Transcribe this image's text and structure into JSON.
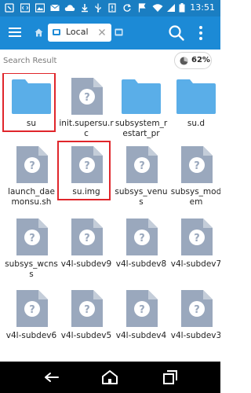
{
  "status_bar": {
    "time": "13:51",
    "icons": [
      "nfc-icon",
      "code-icon",
      "image-icon",
      "mail-icon",
      "cloud-icon",
      "download-icon",
      "usb-icon",
      "notification-icon",
      "restart-icon",
      "flag-icon",
      "wifi-icon",
      "signal-icon",
      "battery-icon"
    ]
  },
  "app_bar": {
    "menu_icon": "hamburger-menu-icon",
    "home_icon": "home-icon",
    "tab_label": "Local",
    "tab_icon": "phone-icon",
    "tab_close_icon": "close-icon",
    "search_icon": "search-icon",
    "more_icon": "more-vert-icon",
    "accent_color": "#1c8ad6"
  },
  "subheader": {
    "title": "Search Result",
    "storage_percent": "62%"
  },
  "grid": {
    "rows": [
      [
        {
          "name": "su",
          "type": "folder",
          "highlighted": true
        },
        {
          "name": "init.supersu.rc",
          "type": "file",
          "highlighted": false
        },
        {
          "name": "subsystem_restart_pr",
          "type": "folder",
          "highlighted": false
        },
        {
          "name": "su.d",
          "type": "folder",
          "highlighted": false
        }
      ],
      [
        {
          "name": "launch_daemonsu.sh",
          "type": "file",
          "highlighted": false
        },
        {
          "name": "su.img",
          "type": "file",
          "highlighted": true
        },
        {
          "name": "subsys_venus",
          "type": "file",
          "highlighted": false
        },
        {
          "name": "subsys_modem",
          "type": "file",
          "highlighted": false
        }
      ],
      [
        {
          "name": "subsys_wcnss",
          "type": "file",
          "highlighted": false
        },
        {
          "name": "v4l-subdev9",
          "type": "file",
          "highlighted": false
        },
        {
          "name": "v4l-subdev8",
          "type": "file",
          "highlighted": false
        },
        {
          "name": "v4l-subdev7",
          "type": "file",
          "highlighted": false
        }
      ],
      [
        {
          "name": "v4l-subdev6",
          "type": "file",
          "highlighted": false
        },
        {
          "name": "v4l-subdev5",
          "type": "file",
          "highlighted": false
        },
        {
          "name": "v4l-subdev4",
          "type": "file",
          "highlighted": false
        },
        {
          "name": "v4l-subdev3",
          "type": "file",
          "highlighted": false
        }
      ]
    ],
    "highlight_color": "#e0262b",
    "folder_color": "#5aaee8",
    "file_color": "#9aa8bd"
  },
  "nav_bar": {
    "buttons": [
      "back-icon",
      "home-nav-icon",
      "recents-icon"
    ]
  }
}
